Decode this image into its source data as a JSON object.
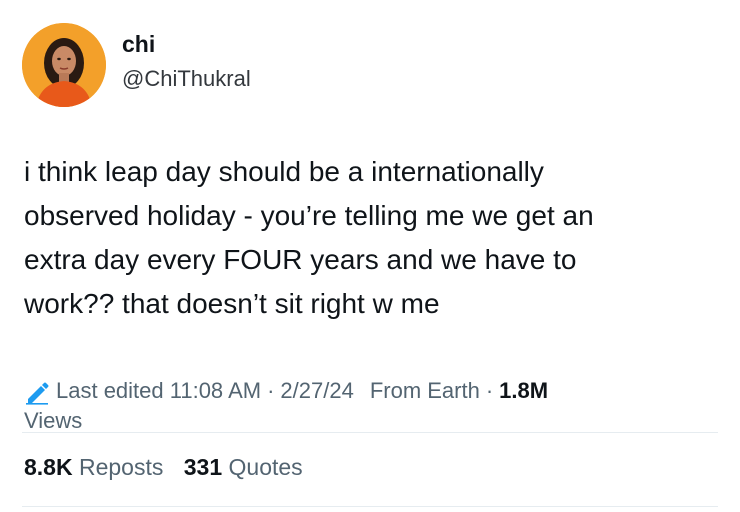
{
  "author": {
    "display_name": "chi",
    "handle": "@ChiThukral",
    "avatar_icon": "profile-photo"
  },
  "tweet": {
    "lines": [
      "i think leap day should be a internationally",
      "observed holiday - you’re telling me we get an",
      "extra day every FOUR years and we have to",
      "work?? that doesn’t sit right w me"
    ]
  },
  "meta": {
    "edit_icon": "pencil-icon",
    "edited_label": "Last edited 11:08 AM",
    "separator": "·",
    "date": "2/27/24",
    "source": "From Earth",
    "views_count": "1.8M",
    "views_label": "Views"
  },
  "stats": {
    "reposts_count": "8.8K",
    "reposts_label": "Reposts",
    "quotes_count": "331",
    "quotes_label": "Quotes"
  },
  "colors": {
    "text_primary": "#0f1419",
    "text_secondary": "#536471",
    "edit_icon": "#1d9bf0",
    "divider": "#e6ecf0",
    "avatar_bg": "#f29a1a"
  }
}
